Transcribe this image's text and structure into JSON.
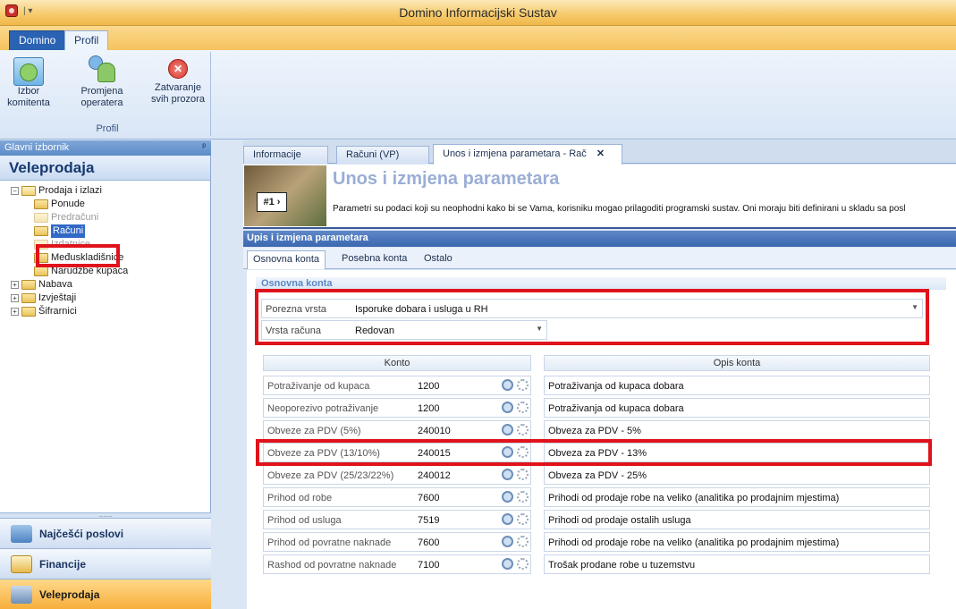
{
  "app": {
    "title": "Domino Informacijski Sustav"
  },
  "ribbon": {
    "tabs": [
      "Domino",
      "Profil"
    ],
    "buttons": [
      {
        "line1": "Izbor",
        "line2": "komitenta",
        "icon": "client-folder-icon"
      },
      {
        "line1": "Promjena",
        "line2": "operatera",
        "icon": "users-icon"
      },
      {
        "line1": "Zatvaranje",
        "line2": "svih prozora",
        "icon": "close-all-icon"
      }
    ],
    "group_label": "Profil"
  },
  "left": {
    "header": "Glavni izbornik",
    "pin": "ᵖ",
    "section_title": "Veleprodaja",
    "tree": {
      "root": "Prodaja i izlazi",
      "children": [
        "Ponude",
        "Predračuni",
        "Računi",
        "Izdatnice",
        "Međuskladišnice",
        "Narudžbe kupaca"
      ],
      "others": [
        "Nabava",
        "Izvještaji",
        "Šifrarnici"
      ]
    },
    "nav": [
      "Najčešći poslovi",
      "Financije",
      "Veleprodaja"
    ],
    "grip": "........."
  },
  "doc": {
    "tabs": [
      "Informacije",
      "Računi (VP)",
      "Unos i izmjena parametara - Rač"
    ],
    "close": "✕",
    "banner_title": "Unos i izmjena parametara",
    "banner_desc": "Parametri su podaci koji su neophodni kako bi se Vama, korisniku mogao prilagoditi programski sustav. Oni moraju biti definirani u skladu sa posl",
    "banner_sign": "#1 ›",
    "section": "Upis i izmjena parametara",
    "param_tabs": [
      "Osnovna konta",
      "Posebna konta",
      "Ostalo"
    ],
    "group": "Osnovna konta",
    "porezna": {
      "label": "Porezna vrsta",
      "value": "Isporuke dobara i usluga u RH"
    },
    "vrsta": {
      "label": "Vrsta računa",
      "value": "Redovan"
    },
    "headers": {
      "konto": "Konto",
      "opis": "Opis konta"
    },
    "rows": [
      {
        "label": "Potraživanje od kupaca",
        "konto": "1200",
        "opis": "Potraživanja od kupaca dobara"
      },
      {
        "label": "Neoporezivo potraživanje",
        "konto": "1200",
        "opis": "Potraživanja od kupaca dobara"
      },
      {
        "label": "Obveze za PDV (5%)",
        "konto": "240010",
        "opis": "Obveza za PDV - 5%"
      },
      {
        "label": "Obveze za PDV (13/10%)",
        "konto": "240015",
        "opis": "Obveza za PDV - 13%"
      },
      {
        "label": "Obveze za PDV (25/23/22%)",
        "konto": "240012",
        "opis": "Obveza za PDV - 25%"
      },
      {
        "label": "Prihod od robe",
        "konto": "7600",
        "opis": "Prihodi od prodaje robe na veliko (analitika po prodajnim mjestima)"
      },
      {
        "label": "Prihod od usluga",
        "konto": "7519",
        "opis": "Prihodi od prodaje ostalih usluga"
      },
      {
        "label": "Prihod od povratne naknade",
        "konto": "7600",
        "opis": "Prihodi od prodaje robe na veliko (analitika po prodajnim mjestima)"
      },
      {
        "label": "Rashod od povratne naknade",
        "konto": "7100",
        "opis": "Trošak prodane robe u tuzemstvu"
      }
    ]
  }
}
